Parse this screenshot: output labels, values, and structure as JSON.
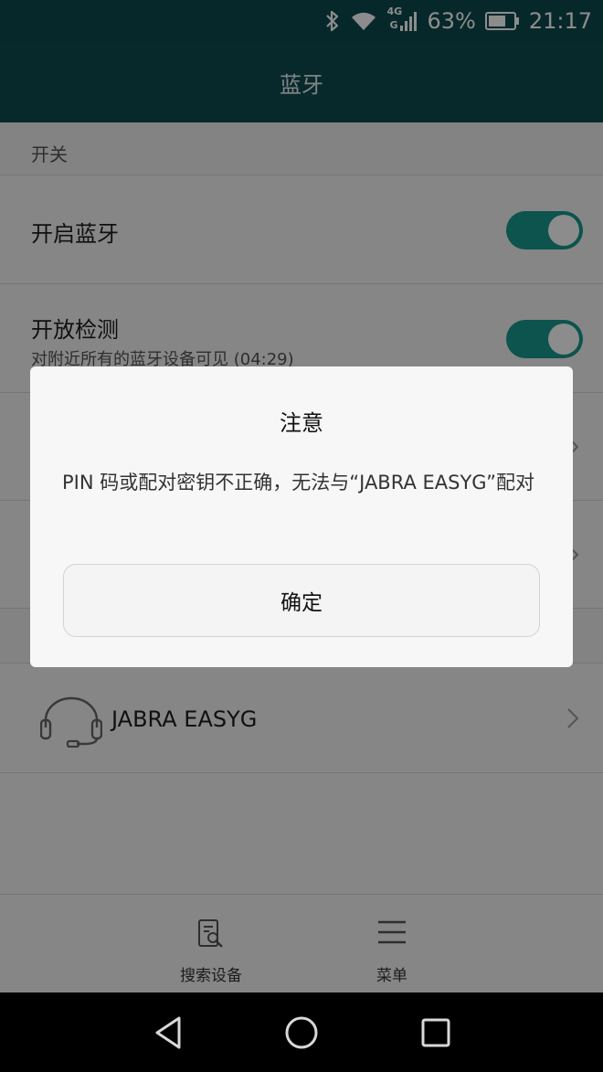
{
  "status_bar": {
    "network_type": "4G",
    "network_type_2": "G",
    "battery": "63%",
    "time": "21:17",
    "icons": [
      "bluetooth-icon",
      "wifi-icon",
      "signal-icon",
      "battery-icon"
    ]
  },
  "app_bar": {
    "title": "蓝牙"
  },
  "section": {
    "switch_header": "开关"
  },
  "settings": {
    "bluetooth": {
      "label": "开启蓝牙",
      "enabled": true
    },
    "visibility": {
      "label": "开放检测",
      "sub": "对附近所有的蓝牙设备可见 (04:29)",
      "enabled": true
    }
  },
  "devices": [
    {
      "name": "JABRA EASYG",
      "icon": "headset-icon"
    }
  ],
  "bottom_nav": {
    "search_label": "搜索设备",
    "menu_label": "菜单"
  },
  "dialog": {
    "title": "注意",
    "message": "PIN 码或配对密钥不正确，无法与“JABRA EASYG”配对",
    "ok_label": "确定"
  },
  "colors": {
    "toolbar": "#0f4c50",
    "accent": "#179a8c"
  }
}
